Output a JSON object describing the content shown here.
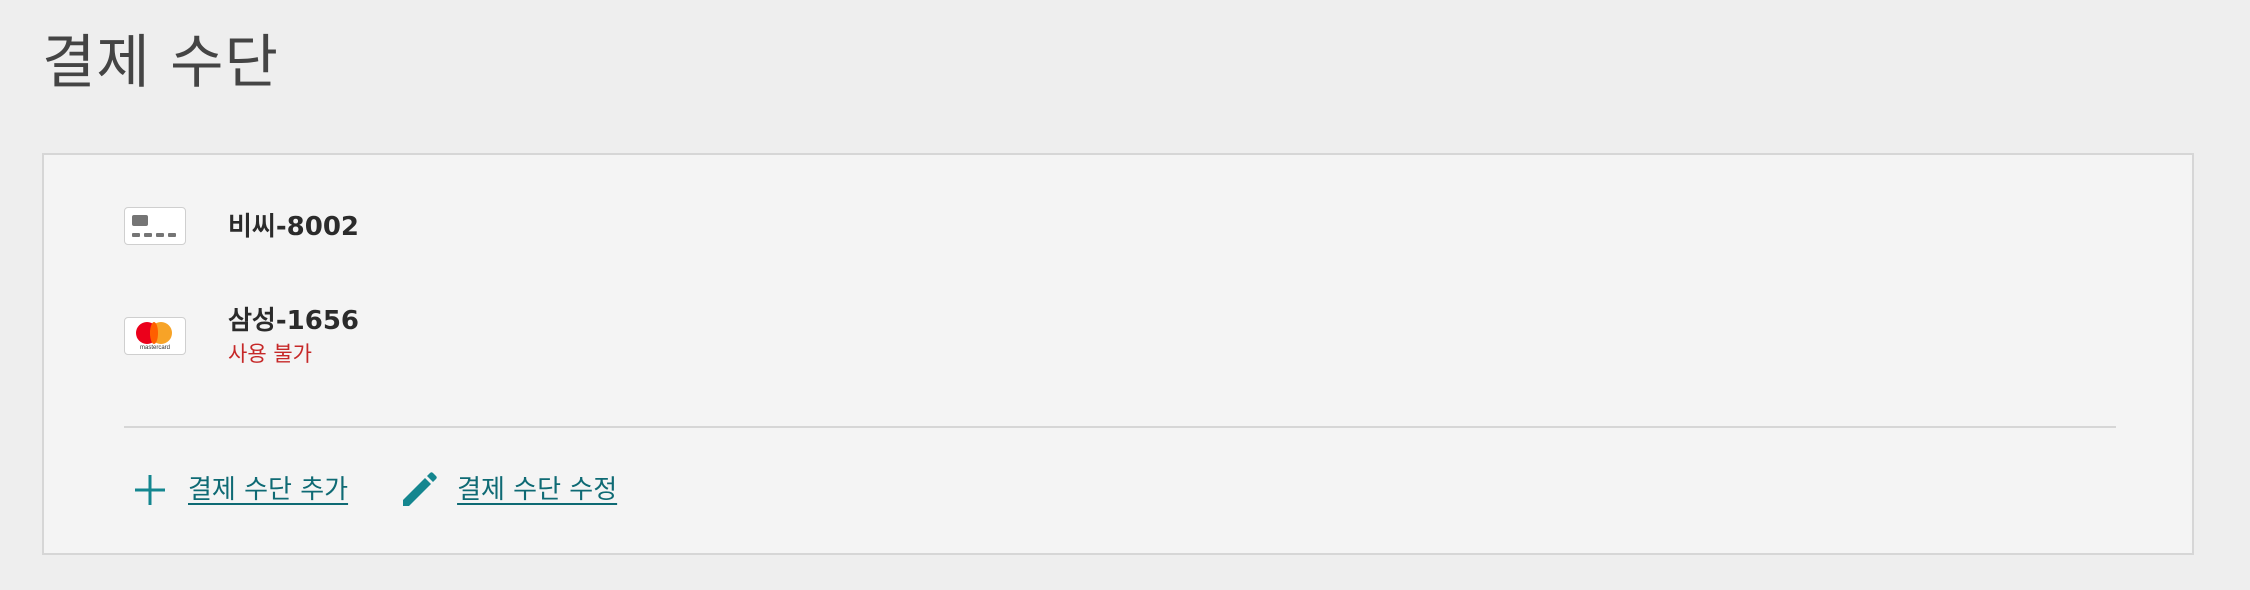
{
  "page": {
    "title": "결제 수단"
  },
  "payment_methods": [
    {
      "name": "비씨-8002",
      "card_icon": "generic-card-icon",
      "status": ""
    },
    {
      "name": "삼성-1656",
      "card_icon": "mastercard-icon",
      "card_icon_text": "mastercard",
      "status": "사용 불가"
    }
  ],
  "actions": {
    "add_label": "결제 수단 추가",
    "add_icon": "plus-icon",
    "edit_label": "결제 수단 수정",
    "edit_icon": "pencil-icon"
  },
  "colors": {
    "page_background": "#eeeeee",
    "panel_background": "#f4f4f4",
    "link": "#0e6a74",
    "icon_accent": "#14868f",
    "status_error": "#c62828"
  }
}
